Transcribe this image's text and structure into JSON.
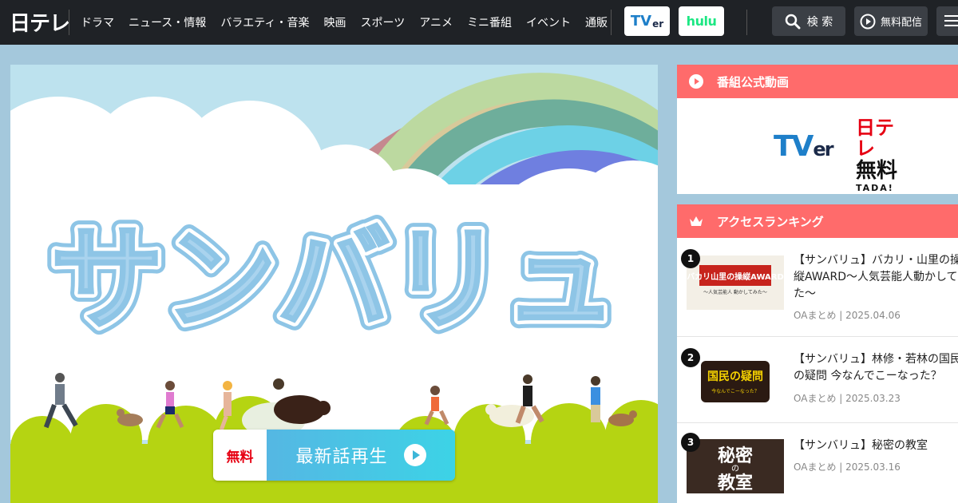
{
  "header": {
    "logo": "日テレ",
    "nav": [
      "ドラマ",
      "ニュース・情報",
      "バラエティ・音楽",
      "映画",
      "スポーツ",
      "アニメ",
      "ミニ番組",
      "イベント",
      "通販"
    ],
    "tver": "TV",
    "tver_suffix": "er",
    "hulu": "hulu",
    "search": "検 索",
    "free_stream": "無料配信"
  },
  "hero": {
    "title": "サンバリュ",
    "play_free_label": "無料",
    "play_label": "最新話再生"
  },
  "sidebar": {
    "official": {
      "heading": "番組公式動画",
      "tver": "TV",
      "tver_suffix": "er",
      "ntv_top": "日テレ",
      "ntv_mid": "無料",
      "ntv_bottom": "TADA!"
    },
    "ranking": {
      "heading": "アクセスランキング",
      "items": [
        {
          "rank": "1",
          "thumb_text": "バカリ山里の操縦AWARD",
          "thumb_sub": "〜人気芸能人 動かしてみた〜",
          "title": "【サンバリュ】バカリ・山里の操縦AWARD〜人気芸能人動かしてみた〜",
          "category": "OAまとめ",
          "date": "2025.04.06"
        },
        {
          "rank": "2",
          "thumb_text": "国民の疑問",
          "thumb_sub": "今なんでこーなった？",
          "title": "【サンバリュ】林修・若林の国民の疑問 今なんでこーなった？",
          "category": "OAまとめ",
          "date": "2025.03.23"
        },
        {
          "rank": "3",
          "thumb_text_top": "秘密",
          "thumb_text_mid": "の",
          "thumb_text_bottom": "教室",
          "title": "【サンバリュ】秘密の教室",
          "category": "OAまとめ",
          "date": "2025.03.16"
        }
      ]
    }
  },
  "colors": {
    "topbar": "#1f2226",
    "accent_red": "#ff6b6b",
    "play_gradient_start": "#55b7e3",
    "play_gradient_end": "#3cd3e6",
    "page_bg": "#a4c8dc"
  }
}
